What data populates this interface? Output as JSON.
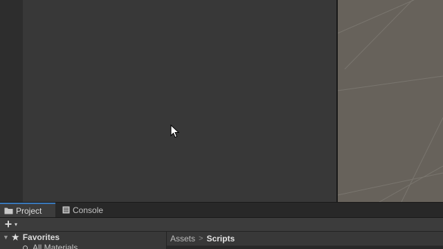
{
  "tabs": [
    {
      "label": "Project",
      "icon": "folder-icon",
      "active": true
    },
    {
      "label": "Console",
      "icon": "console-icon",
      "active": false
    }
  ],
  "toolbar": {
    "add_symbol": "+",
    "add_caret": "▾"
  },
  "tree": {
    "favorites_fold": "▼",
    "favorites_star": "★",
    "favorites_label": "Favorites",
    "all_materials_label": "All Materials"
  },
  "breadcrumb": {
    "items": [
      "Assets",
      "Scripts"
    ],
    "separator": ">"
  },
  "colors": {
    "accent": "#3a79bb",
    "panel": "#383838",
    "scene_background": "#67625b"
  }
}
